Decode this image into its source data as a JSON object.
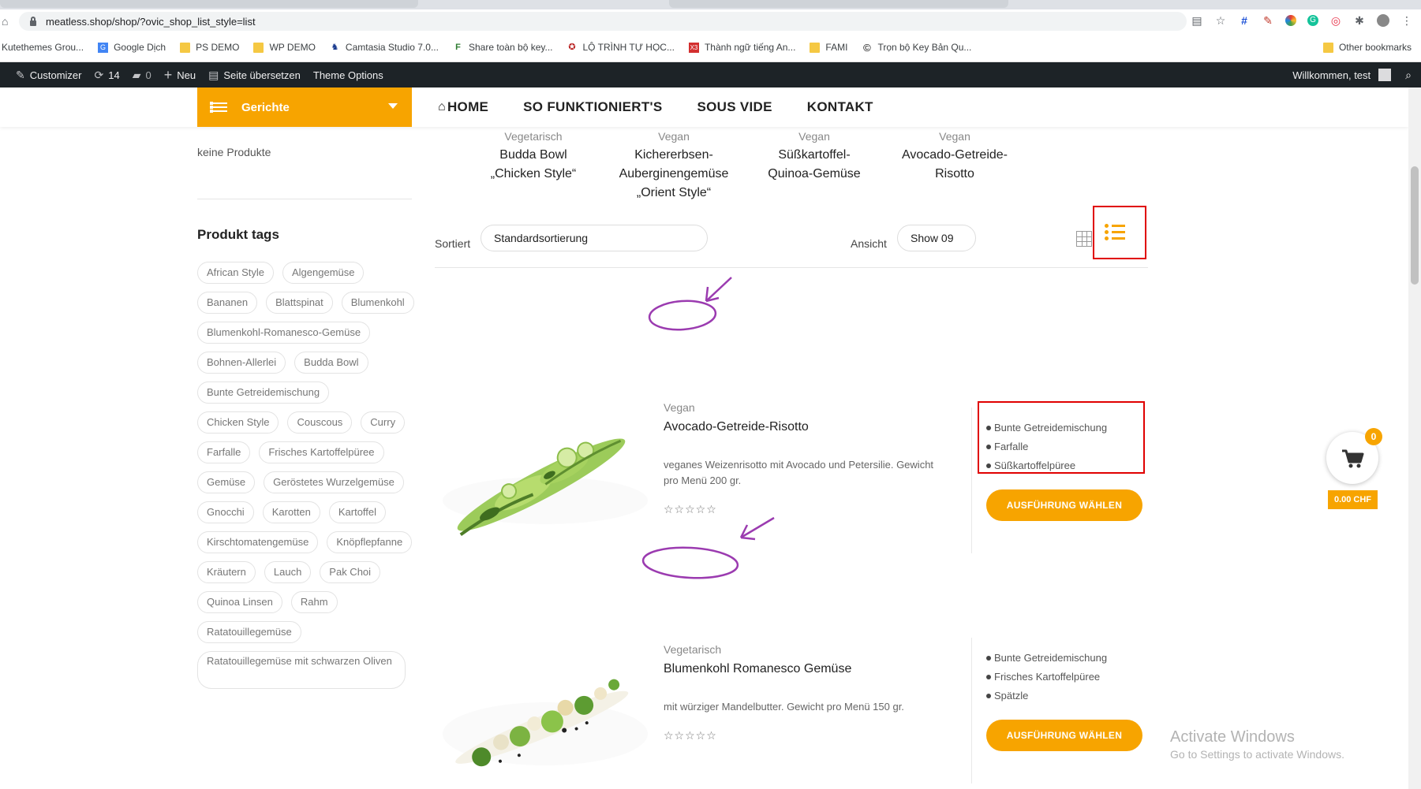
{
  "browser": {
    "url": "meatless.shop/shop/?ovic_shop_list_style=list",
    "bookmarks": [
      {
        "label": "Kutethemes Grou...",
        "icon": "blank-page-icon"
      },
      {
        "label": "Google Dịch",
        "icon": "google-translate-icon"
      },
      {
        "label": "PS DEMO",
        "icon": "folder-icon"
      },
      {
        "label": "WP DEMO",
        "icon": "folder-icon"
      },
      {
        "label": "Camtasia Studio 7.0...",
        "icon": "camtasia-icon"
      },
      {
        "label": "Share toàn bộ key...",
        "icon": "flag-icon"
      },
      {
        "label": "LỘ TRÌNH TỰ HỌC...",
        "icon": "logo-icon"
      },
      {
        "label": "Thành ngữ tiếng An...",
        "icon": "x3-icon"
      },
      {
        "label": "FAMI",
        "icon": "folder-icon"
      },
      {
        "label": "Trọn bộ Key Bản Qu...",
        "icon": "copyright-icon"
      }
    ],
    "other_bookmarks": "Other bookmarks"
  },
  "wpbar": {
    "customizer": "Customizer",
    "updates": "14",
    "comments": "0",
    "new": "Neu",
    "translate": "Seite übersetzen",
    "theme_options": "Theme Options",
    "welcome": "Willkommen, test"
  },
  "header": {
    "category_menu": "Gerichte",
    "nav": [
      "HOME",
      "SO FUNKTIONIERT'S",
      "SOUS VIDE",
      "KONTAKT"
    ]
  },
  "sidebar": {
    "no_products": "keine Produkte",
    "tags_title": "Produkt tags",
    "tags": [
      "African Style",
      "Algengemüse",
      "Bananen",
      "Blattspinat",
      "Blumenkohl",
      "Blumenkohl-Romanesco-Gemüse",
      "Bohnen-Allerlei",
      "Budda Bowl",
      "Bunte Getreidemischung",
      "Chicken Style",
      "Couscous",
      "Curry",
      "Farfalle",
      "Frisches Kartoffelpüree",
      "Gemüse",
      "Geröstetes Wurzelgemüse",
      "Gnocchi",
      "Karotten",
      "Kartoffel",
      "Kirschtomatengemüse",
      "Knöpflepfanne",
      "Kräutern",
      "Lauch",
      "Pak Choi",
      "Quinoa Linsen",
      "Rahm",
      "Ratatouillegemüse"
    ],
    "tag_multiline": "Ratatouillegemüse mit schwarzen Oliven"
  },
  "featured": [
    {
      "category": "Vegetarisch",
      "name_lines": [
        "Budda Bowl",
        "„Chicken Style“"
      ]
    },
    {
      "category": "Vegan",
      "name_lines": [
        "Kichererbsen-",
        "Auberginengemüse",
        "„Orient Style“"
      ]
    },
    {
      "category": "Vegan",
      "name_lines": [
        "Süßkartoffel-",
        "Quinoa-Gemüse"
      ]
    },
    {
      "category": "Vegan",
      "name_lines": [
        "Avocado-Getreide-",
        "Risotto"
      ]
    }
  ],
  "toolbar": {
    "sort_label": "Sortiert",
    "sort_value": "Standardsortierung",
    "view_label": "Ansicht",
    "view_value": "Show 09"
  },
  "products": [
    {
      "category": "Vegan",
      "name": "Avocado-Getreide-Risotto",
      "description": "veganes Weizenrisotto mit Avocado und Petersilie. Gewicht pro Menü 200 gr.",
      "rating": 0,
      "options": [
        "Bunte Getreidemischung",
        "Farfalle",
        "Süßkartoffelpüree"
      ],
      "button": "AUSFÜHRUNG WÄHLEN"
    },
    {
      "category": "Vegetarisch",
      "name": "Blumenkohl Romanesco Gemüse",
      "description": "mit würziger Mandelbutter. Gewicht pro Menü 150 gr.",
      "rating": 0,
      "options": [
        "Bunte Getreidemischung",
        "Frisches Kartoffelpüree",
        "Spätzle"
      ],
      "button": "AUSFÜHRUNG WÄHLEN"
    }
  ],
  "cart": {
    "count": "0",
    "total": "0.00 CHF"
  },
  "watermark": {
    "title": "Activate Windows",
    "subtitle": "Go to Settings to activate Windows."
  },
  "colors": {
    "accent": "#f7a400",
    "annotation_red": "#e00000",
    "annotation_purple": "#9b3bb0",
    "admin_bar": "#1d2327"
  }
}
